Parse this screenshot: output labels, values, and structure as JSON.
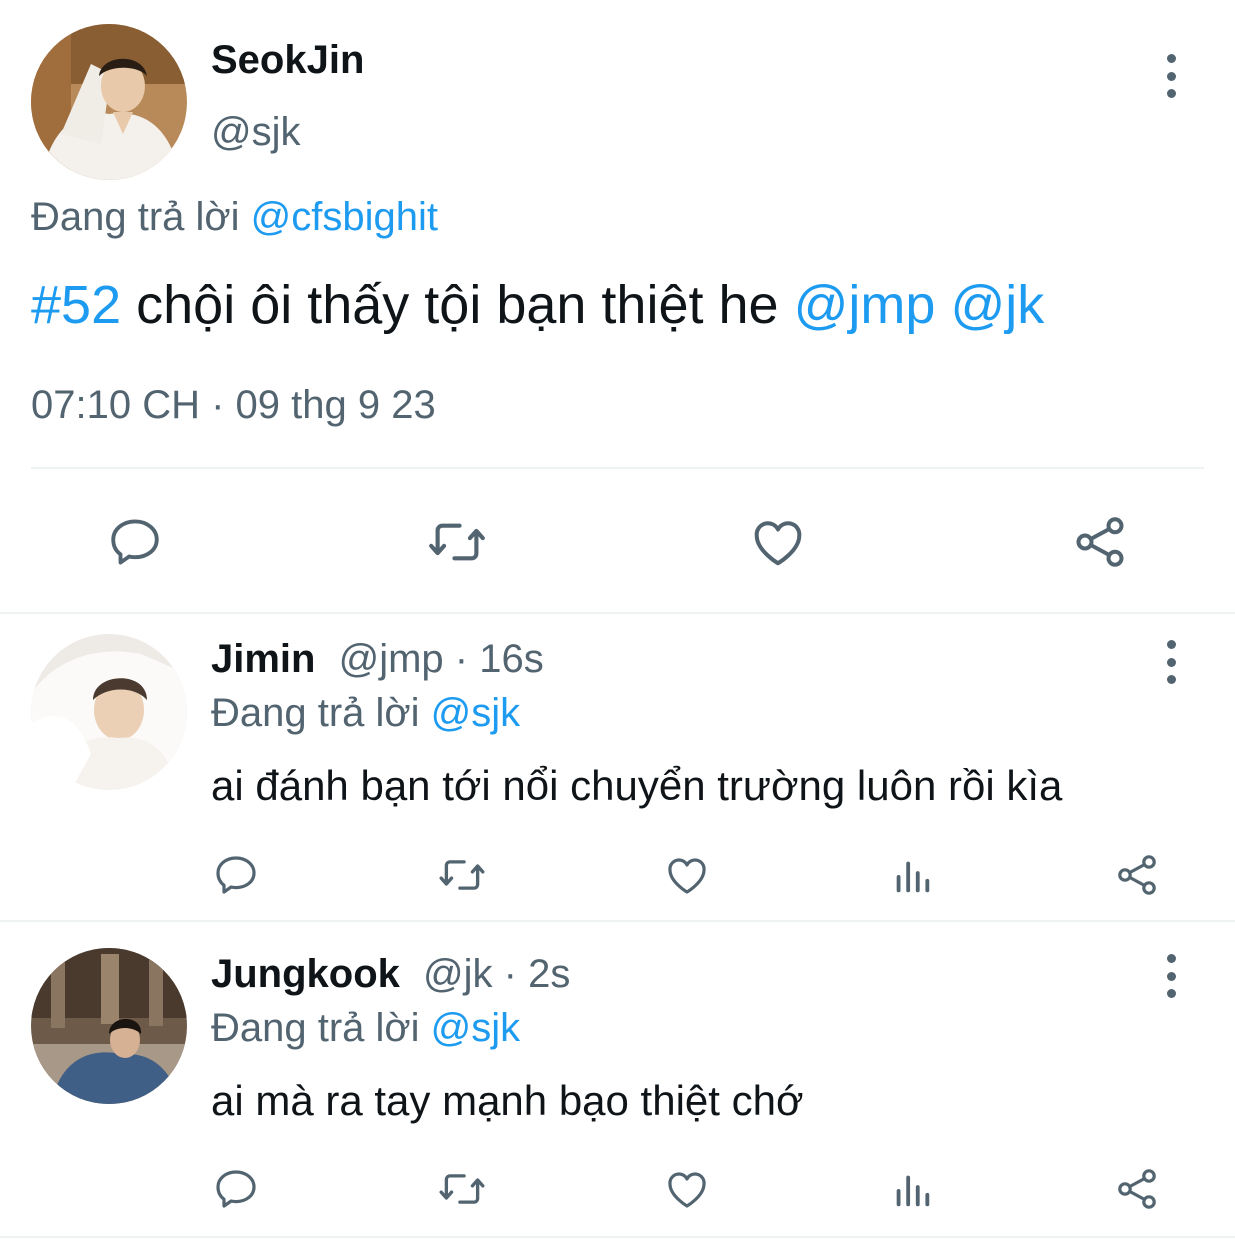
{
  "main_tweet": {
    "display_name": "SeokJin",
    "handle": "@sjk",
    "replying_prefix": "Đang trả lời",
    "replying_to": "@cfsbighit",
    "hashtag": "#52",
    "text": "chội ôi thấy tội bạn thiệt he",
    "mention_1": "@jmp",
    "mention_2": "@jk",
    "timestamp": "07:10 CH · 09 thg 9 23",
    "actions": [
      "reply-icon",
      "retweet-icon",
      "like-icon",
      "share-icon"
    ]
  },
  "replies": [
    {
      "display_name": "Jimin",
      "handle_time": "@jmp · 16s",
      "replying_prefix": "Đang trả lời",
      "replying_to": "@sjk",
      "text": "ai đánh bạn tới nổi chuyển trường luôn rồi kìa",
      "actions": [
        "reply-icon",
        "retweet-icon",
        "like-icon",
        "analytics-icon",
        "share-icon"
      ]
    },
    {
      "display_name": "Jungkook",
      "handle_time": "@jk · 2s",
      "replying_prefix": "Đang trả lời",
      "replying_to": "@sjk",
      "text": "ai mà ra tay mạnh bạo thiệt chớ",
      "actions": [
        "reply-icon",
        "retweet-icon",
        "like-icon",
        "analytics-icon",
        "share-icon"
      ]
    }
  ],
  "colors": {
    "accent": "#1d9bf0",
    "text": "#0f1419",
    "secondary": "#536471",
    "divider": "#eff3f4"
  }
}
